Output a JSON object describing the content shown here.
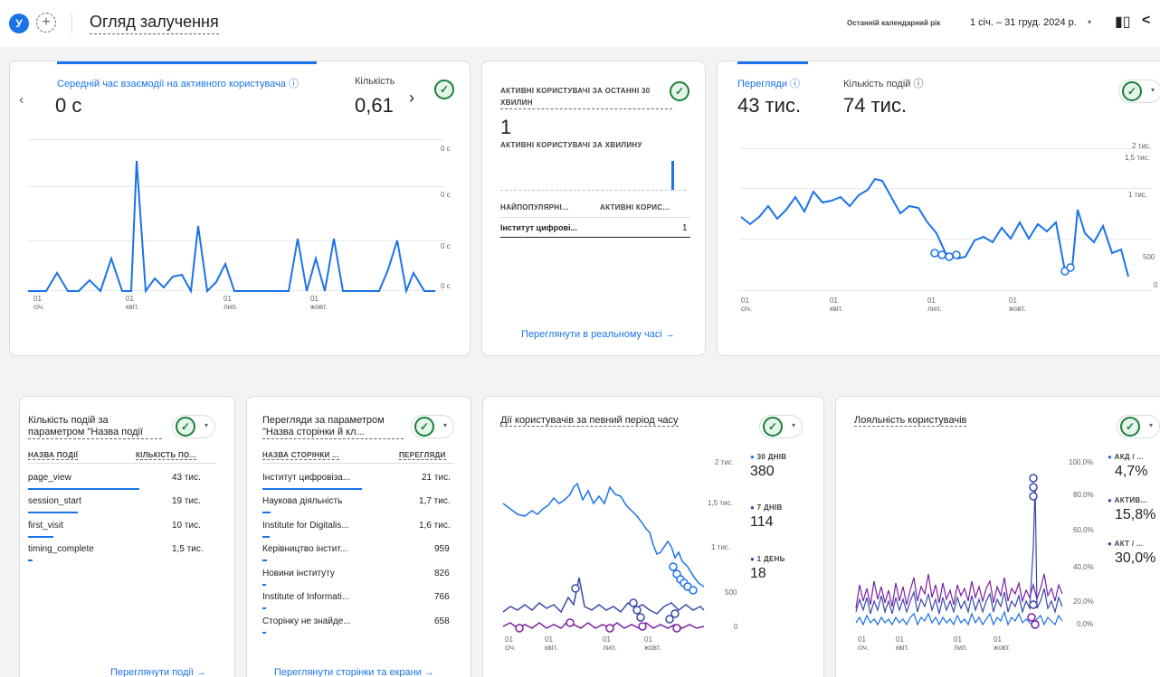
{
  "header": {
    "avatar_letter": "У",
    "add_icon": "+",
    "title": "Огляд залучення",
    "date_range_label": "Останній календарний рік",
    "date_range_value": "1 січ. – 31 груд. 2024 р.",
    "caret": "▾",
    "compare_icon": "▮▯",
    "share_icon": "<"
  },
  "card1": {
    "metric_label": "Середній час взаємодії на активного користувача ⓘ",
    "metric_value": "0 с",
    "count_label": "Кількість",
    "count_value": "0,61",
    "prev_arrow": "‹",
    "next_arrow": "›",
    "check": "✓",
    "y_ticks": [
      "0 с",
      "0 с",
      "0 с",
      "0 с"
    ],
    "x_ticks": [
      {
        "top": "01",
        "bottom": "січ."
      },
      {
        "top": "01",
        "bottom": "квіт."
      },
      {
        "top": "01",
        "bottom": "лип."
      },
      {
        "top": "01",
        "bottom": "жовт."
      }
    ]
  },
  "card2": {
    "title": "АКТИВНІ КОРИСТУВАЧІ ЗА ОСТАННІ 30 ХВИЛИН",
    "value": "1",
    "subtitle": "АКТИВНІ КОРИСТУВАЧІ ЗА ХВИЛИНУ",
    "col1": "НАЙПОПУЛЯРНІ...",
    "col2": "АКТИВНІ КОРИС...",
    "row_label": "Інститут цифрові...",
    "row_value": "1",
    "check": "✓",
    "link": "Переглянути в реальному часі →"
  },
  "card3": {
    "metric1_label": "Перегляди ⓘ",
    "metric1_value": "43 тис.",
    "metric2_label": "Кількість подій ⓘ",
    "metric2_value": "74 тис.",
    "check": "✓",
    "caret": "▾",
    "y_ticks": [
      "2 тис.",
      "1,5 тис.",
      "1 тис.",
      "500",
      "0"
    ],
    "x_ticks": [
      {
        "top": "01",
        "bottom": "січ."
      },
      {
        "top": "01",
        "bottom": "квіт."
      },
      {
        "top": "01",
        "bottom": "лип."
      },
      {
        "top": "01",
        "bottom": "жовт."
      }
    ]
  },
  "card4": {
    "title": "Кількість подій за параметром \"Назва події",
    "col1": "НАЗВА ПОДІЇ",
    "col2": "КІЛЬКІСТЬ ПО...",
    "rows": [
      {
        "label": "page_view",
        "value": "43 тис."
      },
      {
        "label": "session_start",
        "value": "19 тис."
      },
      {
        "label": "first_visit",
        "value": "10 тис."
      },
      {
        "label": "timing_complete",
        "value": "1,5 тис."
      }
    ],
    "check": "✓",
    "caret": "▾",
    "link": "Переглянути події →"
  },
  "card5": {
    "title": "Перегляди за параметром \"Назва сторінки й кл...",
    "col1": "НАЗВА СТОРІНКИ ...",
    "col2": "ПЕРЕГЛЯДИ",
    "rows": [
      {
        "label": "Інститут цифровіза...",
        "value": "21 тис."
      },
      {
        "label": "Наукова діяльність",
        "value": "1,7 тис."
      },
      {
        "label": "Institute for Digitalis...",
        "value": "1,6 тис."
      },
      {
        "label": "Керівництво інстит...",
        "value": "959"
      },
      {
        "label": "Новини інституту",
        "value": "826"
      },
      {
        "label": "Institute of Informati...",
        "value": "766"
      },
      {
        "label": "Сторінку не знайде...",
        "value": "658"
      }
    ],
    "check": "✓",
    "caret": "▾",
    "link": "Переглянути сторінки та екрани →"
  },
  "card6": {
    "title": "Дії користувачів за певний період часу",
    "check": "✓",
    "caret": "▾",
    "legend": [
      {
        "label": "30 ДНІВ",
        "value": "380",
        "color": "#1a73e8"
      },
      {
        "label": "7 ДНІВ",
        "value": "114",
        "color": "#3949ab"
      },
      {
        "label": "1 ДЕНЬ",
        "value": "18",
        "color": "#7b1fa2"
      }
    ],
    "y_ticks": [
      "2 тис.",
      "1,5 тис.",
      "1 тис.",
      "500",
      "0"
    ],
    "x_ticks": [
      {
        "top": "01",
        "bottom": "січ."
      },
      {
        "top": "01",
        "bottom": "квіт."
      },
      {
        "top": "01",
        "bottom": "лип."
      },
      {
        "top": "01",
        "bottom": "жовт."
      }
    ]
  },
  "card7": {
    "title": "Лояльність користувачів",
    "check": "✓",
    "caret": "▾",
    "legend": [
      {
        "label": "АКД / ...",
        "value": "4,7%",
        "color": "#1a73e8"
      },
      {
        "label": "АКТИВ...",
        "value": "15,8%",
        "color": "#3949ab"
      },
      {
        "label": "АКТ / ...",
        "value": "30,0%",
        "color": "#7b1fa2"
      }
    ],
    "y_ticks": [
      "100,0%",
      "80,0%",
      "60,0%",
      "40,0%",
      "20,0%",
      "0,0%"
    ],
    "x_ticks": [
      {
        "top": "01",
        "bottom": "січ."
      },
      {
        "top": "01",
        "bottom": "квіт."
      },
      {
        "top": "01",
        "bottom": "лип."
      },
      {
        "top": "01",
        "bottom": "жовт."
      }
    ]
  },
  "colors": {
    "accent": "#1a73e8",
    "success": "#188038",
    "series_30d": "#1a73e8",
    "series_7d": "#3949ab",
    "series_1d": "#7b1fa2"
  }
}
